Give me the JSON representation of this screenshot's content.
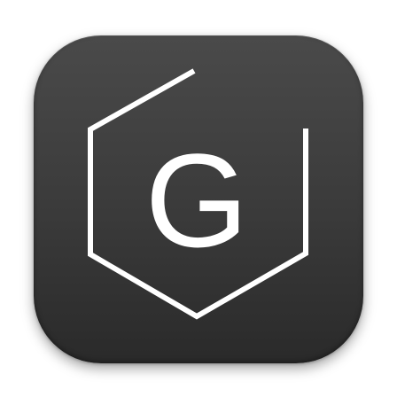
{
  "app_icon": {
    "name": "G",
    "letter": "G",
    "background_color": "#3c3c3c",
    "foreground_color": "#ffffff",
    "icon": "hexagon-outline-icon"
  }
}
